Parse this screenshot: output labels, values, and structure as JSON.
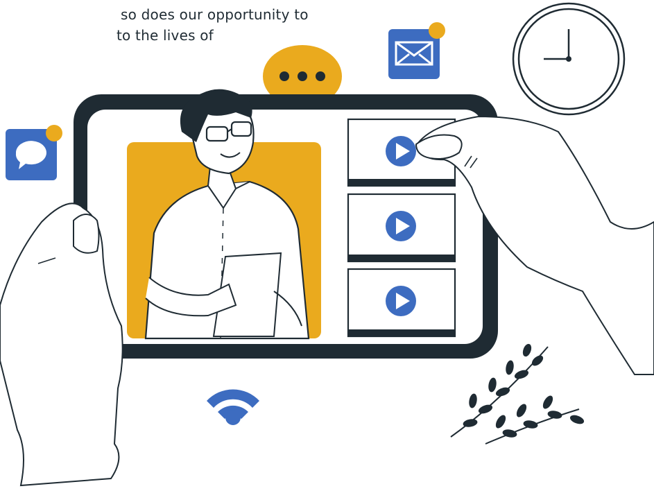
{
  "caption": {
    "line1": "so does our opportunity to",
    "line2": "to the lives of"
  },
  "colors": {
    "ink": "#1f2b33",
    "accent": "#EAAA1E",
    "blue": "#3d6cc0",
    "white": "#ffffff"
  },
  "icons": {
    "chat_badge": "chat-bubble-icon",
    "mail_badge": "mail-icon",
    "speech": "speech-bubble-ellipsis-icon",
    "clock": "clock-icon",
    "wifi": "wifi-icon",
    "play": "play-icon",
    "plant": "leaf-branch-icon"
  },
  "video_list": {
    "items": [
      {
        "icon": "play-icon"
      },
      {
        "icon": "play-icon"
      },
      {
        "icon": "play-icon"
      }
    ]
  }
}
